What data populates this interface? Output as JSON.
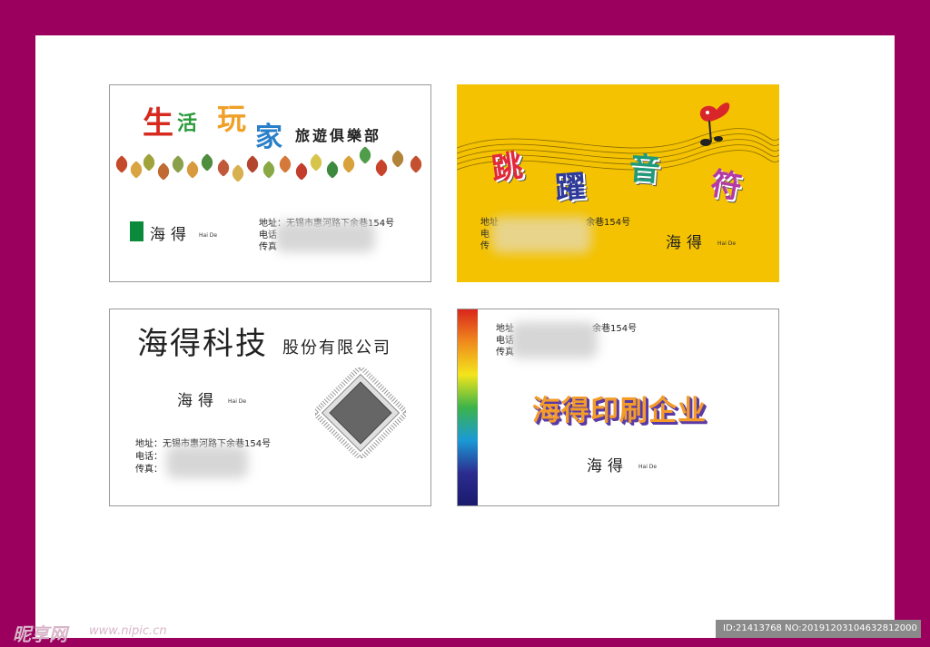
{
  "card1": {
    "title_chars": [
      {
        "char": "生",
        "color": "#d62a1f"
      },
      {
        "char": "活",
        "color": "#2a9a3a"
      },
      {
        "char": "玩",
        "color": "#f0a028"
      },
      {
        "char": "家",
        "color": "#2a80c8"
      }
    ],
    "subtitle": "旅遊俱樂部",
    "name": "海得",
    "pinyin": "Hai De",
    "address_line": "地址：无锡市惠河路下余巷154号",
    "phone_label": "电话",
    "fax_label": "传真"
  },
  "card2": {
    "title_chars": [
      {
        "char": "跳",
        "color": "#e2283c"
      },
      {
        "char": "躍",
        "color": "#2e3a9a"
      },
      {
        "char": "音",
        "color": "#1f9a7a"
      },
      {
        "char": "符",
        "color": "#b43aa8"
      }
    ],
    "address_label": "地址",
    "address_tail": "余巷154号",
    "phone_label": "电",
    "fax_label": "传",
    "name": "海得",
    "pinyin": "Hai De"
  },
  "card3": {
    "company_main": "海得科技",
    "company_sub": "股份有限公司",
    "name": "海得",
    "pinyin": "Hai De",
    "address_line": "地址：无锡市惠河路下余巷154号",
    "phone_label": "电话：",
    "fax_label": "传真："
  },
  "card4": {
    "address_label": "地址",
    "address_tail": "余巷154号",
    "phone_label": "电话",
    "fax_label": "传真",
    "company": "海得印刷企业",
    "name": "海得",
    "pinyin": "Hai De"
  },
  "watermark": {
    "logo_text": "昵享网",
    "url": "www.nipic.cn"
  },
  "id_bar": "ID:21413768 NO:20191203104632812000",
  "colors": {
    "border": "#9b005e",
    "card2_bg": "#f4c200",
    "green_bar": "#0a8a3a"
  }
}
